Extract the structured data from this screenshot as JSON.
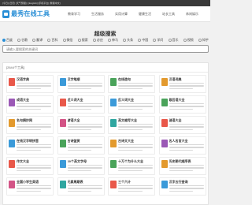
{
  "topbar": {
    "text": "[今日] [日历] [天气预报] | [English] [手机平台] [繁體中文]"
  },
  "header": {
    "logo": "最秀在线工具"
  },
  "nav": [
    "教育学习",
    "生活服务",
    "实用计算",
    "健康生活",
    "站长工具",
    "休闲娱乐"
  ],
  "search": {
    "title": "超级搜索",
    "engines": [
      {
        "label": "百度",
        "selected": true
      },
      {
        "label": "谷歌",
        "selected": false
      },
      {
        "label": "翻译",
        "selected": false
      },
      {
        "label": "百科",
        "selected": false
      },
      {
        "label": "微信",
        "selected": false
      },
      {
        "label": "搜索",
        "selected": false
      },
      {
        "label": "必应",
        "selected": false
      },
      {
        "label": "神马",
        "selected": false
      },
      {
        "label": "头条",
        "selected": false
      },
      {
        "label": "中国",
        "selected": false
      },
      {
        "label": "学问",
        "selected": false
      },
      {
        "label": "音乐",
        "selected": false
      },
      {
        "label": "视频",
        "selected": false
      },
      {
        "label": "知乎",
        "selected": false
      }
    ],
    "placeholder": "请输入要搜索的关键词"
  },
  "panel": {
    "heading": "[2644个工具]",
    "tools": [
      {
        "title": "汉语字典",
        "color": "#e9584a"
      },
      {
        "title": "汉字笔顺",
        "color": "#3b9ad9"
      },
      {
        "title": "在线造句",
        "color": "#4aa35a"
      },
      {
        "title": "汉语词典",
        "color": "#e39a2e"
      },
      {
        "title": "成语大全",
        "color": "#9b59b6"
      },
      {
        "title": "近义词大全",
        "color": "#e9584a"
      },
      {
        "title": "反义词大全",
        "color": "#3b9ad9"
      },
      {
        "title": "歇后语大全",
        "color": "#4aa35a"
      },
      {
        "title": "名句摘抄网",
        "color": "#e39a2e"
      },
      {
        "title": "谚语大全",
        "color": "#d35486"
      },
      {
        "title": "英文缩写大全",
        "color": "#2fa6a0"
      },
      {
        "title": "谜语大全",
        "color": "#e9584a"
      },
      {
        "title": "在线汉字转拼音",
        "color": "#3b9ad9"
      },
      {
        "title": "古诗鉴赏",
        "color": "#4aa35a"
      },
      {
        "title": "古诗文大全",
        "color": "#e39a2e"
      },
      {
        "title": "名人名言大全",
        "color": "#9b59b6"
      },
      {
        "title": "作文大全",
        "color": "#e9584a"
      },
      {
        "title": "20个英文字母",
        "color": "#3b9ad9"
      },
      {
        "title": "十万个为什么大全",
        "color": "#4aa35a"
      },
      {
        "title": "历史朝代顺序表",
        "color": "#e39a2e"
      },
      {
        "title": "全国小学生英语",
        "color": "#d35486"
      },
      {
        "title": "元素周期表",
        "color": "#2fa6a0"
      },
      {
        "title": "三个六计",
        "color": "#e9584a"
      },
      {
        "title": "汉字五行查询",
        "color": "#3b9ad9"
      }
    ]
  }
}
